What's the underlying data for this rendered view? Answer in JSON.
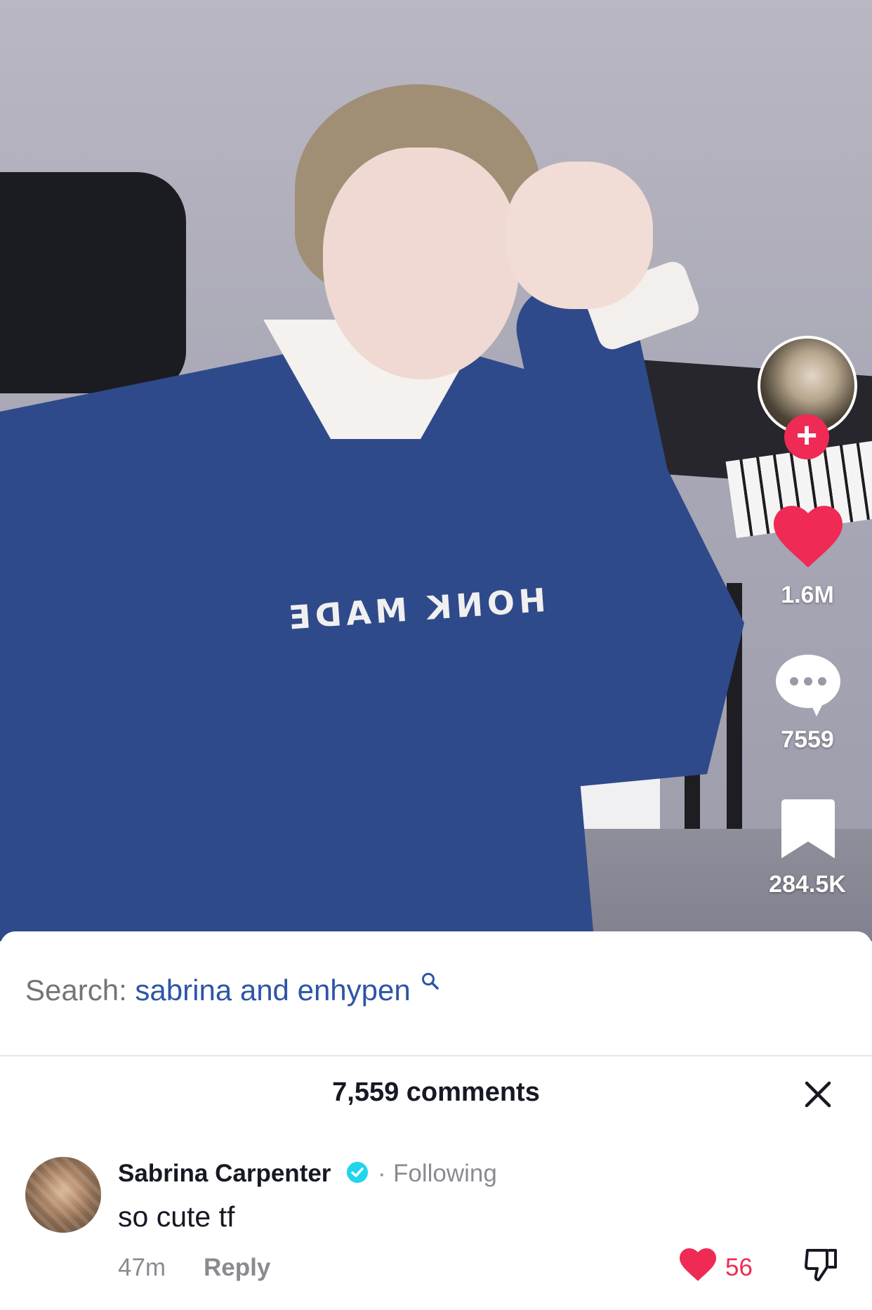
{
  "video": {
    "shirt_print": "HONK MADE"
  },
  "actions": {
    "likes": "1.6M",
    "comments": "7559",
    "saves": "284.5K",
    "follow_symbol": "+"
  },
  "search": {
    "label": "Search:",
    "query": "sabrina and enhypen"
  },
  "comments_panel": {
    "title": "7,559 comments",
    "items": [
      {
        "username": "Sabrina Carpenter",
        "verified": true,
        "separator": "·",
        "relation": "Following",
        "text": "so cute tf",
        "time": "47m",
        "reply_label": "Reply",
        "likes": "56"
      }
    ]
  },
  "colors": {
    "accent_red": "#ee2a55",
    "search_blue": "#2d55a6",
    "verified_blue": "#20d5ec",
    "muted_gray": "#8a8b91"
  },
  "icons": [
    "heart-icon",
    "comment-bubble-icon",
    "bookmark-icon",
    "search-icon",
    "close-icon",
    "verified-badge-icon",
    "dislike-icon",
    "plus-icon"
  ]
}
